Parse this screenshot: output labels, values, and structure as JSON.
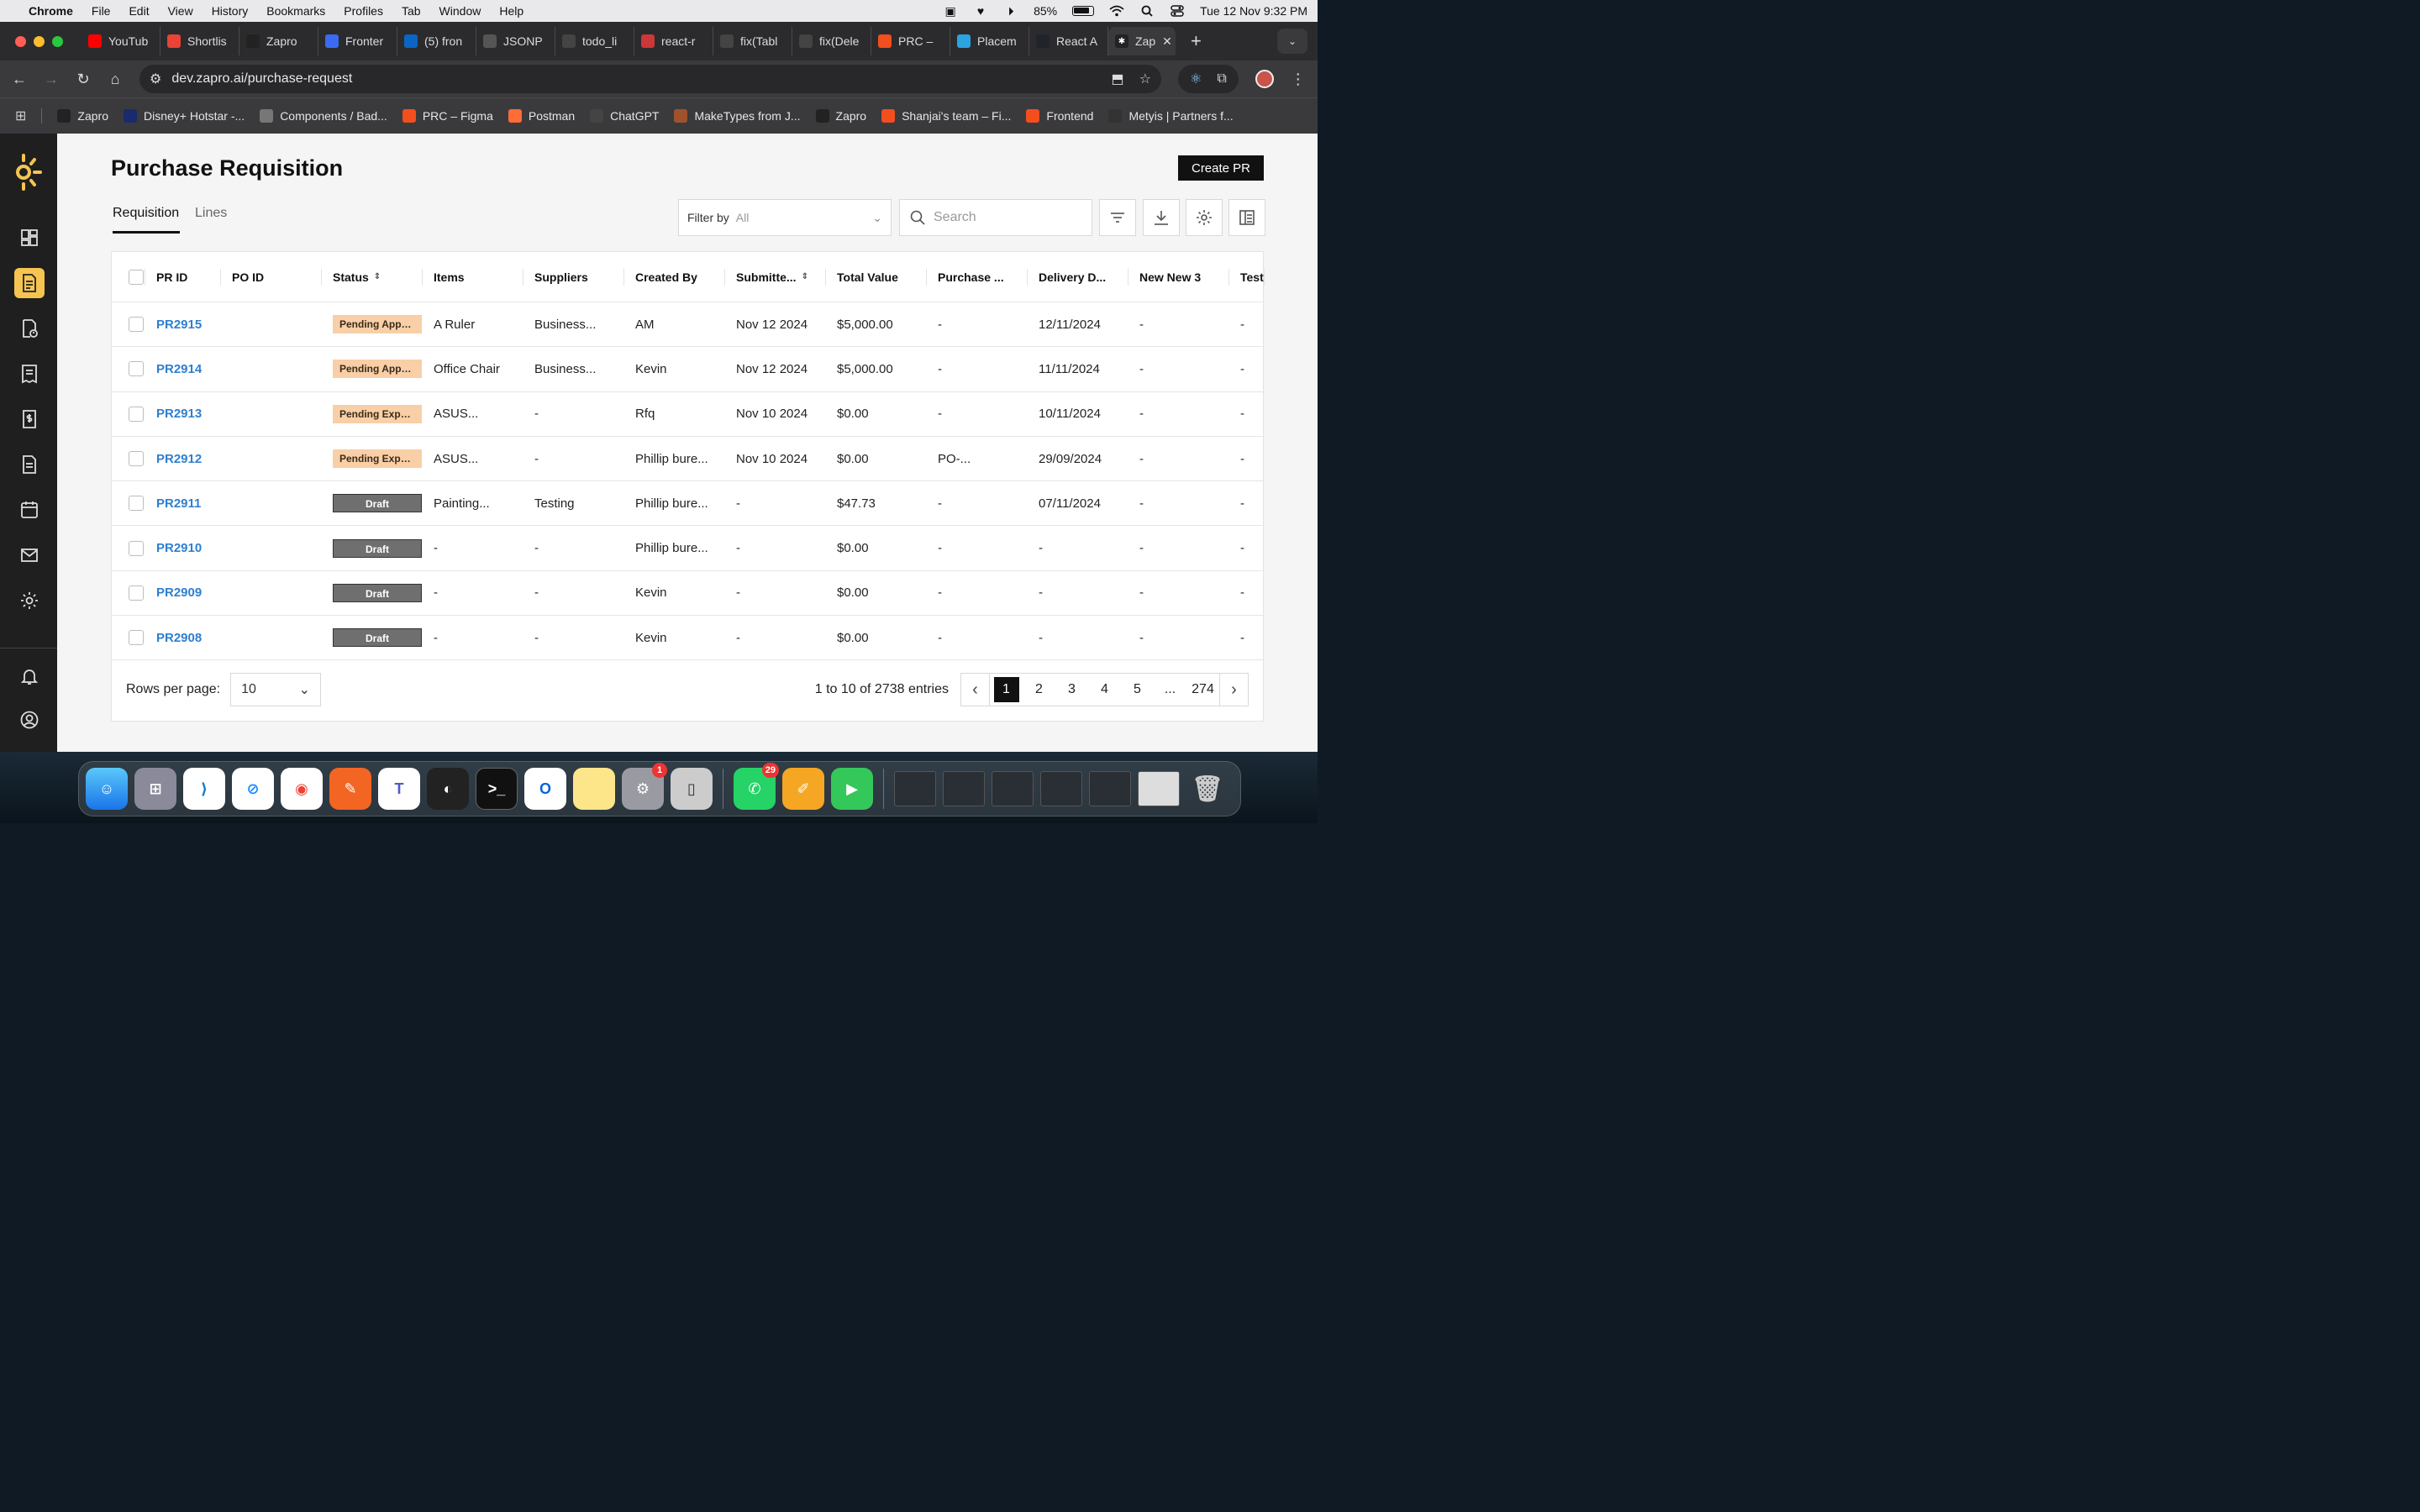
{
  "menubar": {
    "app": "Chrome",
    "items": [
      "File",
      "Edit",
      "View",
      "History",
      "Bookmarks",
      "Profiles",
      "Tab",
      "Window",
      "Help"
    ],
    "battery": "85%",
    "datetime": "Tue 12 Nov  9:32 PM"
  },
  "browser": {
    "tabs": [
      {
        "label": "YouTub",
        "icon": "youtube-icon",
        "color": "#ff0000"
      },
      {
        "label": "Shortlis",
        "icon": "gmail-icon",
        "color": "#ea4335"
      },
      {
        "label": "Zapro",
        "icon": "zapro-icon",
        "color": "#222222"
      },
      {
        "label": "Fronter",
        "icon": "frontend-icon",
        "color": "#3b6bf0"
      },
      {
        "label": "(5) fron",
        "icon": "linkedin-icon",
        "color": "#0a66c2"
      },
      {
        "label": "JSONP",
        "icon": "json-icon",
        "color": "#555555"
      },
      {
        "label": "todo_li",
        "icon": "github-icon",
        "color": "#444444"
      },
      {
        "label": "react-r",
        "icon": "npm-icon",
        "color": "#cb3837"
      },
      {
        "label": "fix(Tabl",
        "icon": "github-fail-icon",
        "color": "#444444"
      },
      {
        "label": "fix(Dele",
        "icon": "github-fail-icon",
        "color": "#444444"
      },
      {
        "label": "PRC –",
        "icon": "figma-icon",
        "color": "#f24e1e"
      },
      {
        "label": "Placem",
        "icon": "telegram-icon",
        "color": "#2aa3e0"
      },
      {
        "label": "React A",
        "icon": "react-icon",
        "color": "#20232a"
      }
    ],
    "active_tab": {
      "label": "Zap",
      "icon": "zapro-icon"
    },
    "url": "dev.zapro.ai/purchase-request",
    "bookmarks": [
      {
        "label": "Zapro",
        "color": "#222222"
      },
      {
        "label": "Disney+ Hotstar -...",
        "color": "#1a2a6c"
      },
      {
        "label": "Components / Bad...",
        "color": "#777777"
      },
      {
        "label": "PRC – Figma",
        "color": "#f24e1e"
      },
      {
        "label": "Postman",
        "color": "#ff6c37"
      },
      {
        "label": "ChatGPT",
        "color": "#444444"
      },
      {
        "label": "MakeTypes from J...",
        "color": "#a0522d"
      },
      {
        "label": "Zapro",
        "color": "#222222"
      },
      {
        "label": "Shanjai's team – Fi...",
        "color": "#f24e1e"
      },
      {
        "label": "Frontend",
        "color": "#f24e1e"
      },
      {
        "label": "Metyis | Partners f...",
        "color": "#333333"
      }
    ]
  },
  "page": {
    "title": "Purchase Requisition",
    "create_button": "Create PR",
    "tabs": [
      "Requisition",
      "Lines"
    ],
    "filter_label": "Filter by",
    "filter_value": "All",
    "search_placeholder": "Search"
  },
  "table": {
    "columns": [
      "PR ID",
      "PO ID",
      "Status",
      "Items",
      "Suppliers",
      "Created By",
      "Submitte...",
      "Total Value",
      "Purchase ...",
      "Delivery D...",
      "New New 3",
      "Test"
    ],
    "rows": [
      {
        "pr": "PR2915",
        "po": "",
        "status": "Pending Appro...",
        "status_type": "pending",
        "items": "A Ruler",
        "suppliers": "Business...",
        "created_by": "AM",
        "submitted": "Nov 12 2024",
        "total": "$5,000.00",
        "purchase": "-",
        "delivery": "12/11/2024",
        "newnew3": "-",
        "test": "-"
      },
      {
        "pr": "PR2914",
        "po": "",
        "status": "Pending Appro...",
        "status_type": "pending",
        "items": "Office Chair",
        "suppliers": "Business...",
        "created_by": "Kevin",
        "submitted": "Nov 12 2024",
        "total": "$5,000.00",
        "purchase": "-",
        "delivery": "11/11/2024",
        "newnew3": "-",
        "test": "-"
      },
      {
        "pr": "PR2913",
        "po": "",
        "status": "Pending Expert...",
        "status_type": "pending",
        "items": "ASUS...",
        "suppliers": "-",
        "created_by": "Rfq",
        "submitted": "Nov 10 2024",
        "total": "$0.00",
        "purchase": "-",
        "delivery": "10/11/2024",
        "newnew3": "-",
        "test": "-"
      },
      {
        "pr": "PR2912",
        "po": "",
        "status": "Pending Expert...",
        "status_type": "pending",
        "items": "ASUS...",
        "suppliers": "-",
        "created_by": "Phillip bure...",
        "submitted": "Nov 10 2024",
        "total": "$0.00",
        "purchase": "PO-...",
        "delivery": "29/09/2024",
        "newnew3": "-",
        "test": "-"
      },
      {
        "pr": "PR2911",
        "po": "",
        "status": "Draft",
        "status_type": "draft",
        "items": "Painting...",
        "suppliers": "Testing",
        "created_by": "Phillip bure...",
        "submitted": "-",
        "total": "$47.73",
        "purchase": "-",
        "delivery": "07/11/2024",
        "newnew3": "-",
        "test": "-"
      },
      {
        "pr": "PR2910",
        "po": "",
        "status": "Draft",
        "status_type": "draft",
        "items": "-",
        "suppliers": "-",
        "created_by": "Phillip bure...",
        "submitted": "-",
        "total": "$0.00",
        "purchase": "-",
        "delivery": "-",
        "newnew3": "-",
        "test": "-"
      },
      {
        "pr": "PR2909",
        "po": "",
        "status": "Draft",
        "status_type": "draft",
        "items": "-",
        "suppliers": "-",
        "created_by": "Kevin",
        "submitted": "-",
        "total": "$0.00",
        "purchase": "-",
        "delivery": "-",
        "newnew3": "-",
        "test": "-"
      },
      {
        "pr": "PR2908",
        "po": "",
        "status": "Draft",
        "status_type": "draft",
        "items": "-",
        "suppliers": "-",
        "created_by": "Kevin",
        "submitted": "-",
        "total": "$0.00",
        "purchase": "-",
        "delivery": "-",
        "newnew3": "-",
        "test": "-"
      }
    ]
  },
  "pagination": {
    "rows_per_page_label": "Rows per page:",
    "rows_per_page": "10",
    "entries": "1 to 10 of 2738 entries",
    "pages": [
      "1",
      "2",
      "3",
      "4",
      "5",
      "...",
      "274"
    ],
    "current": "1"
  },
  "dock": {
    "whatsapp_badge": "29",
    "settings_badge": "1"
  },
  "colors": {
    "accent": "#f5c451",
    "link": "#2f7fd0",
    "pending": "#f8cfa6",
    "draft": "#6f6f6f"
  }
}
